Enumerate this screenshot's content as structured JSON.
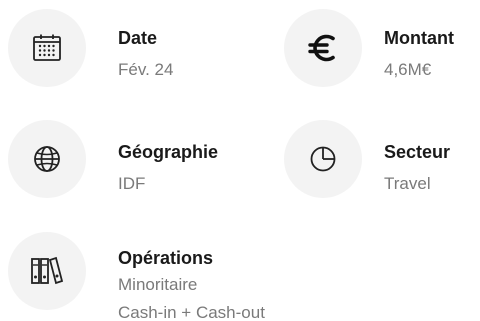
{
  "items": [
    {
      "id": "date",
      "label": "Date",
      "values": [
        "Fév. 24"
      ],
      "icon": "calendar-icon"
    },
    {
      "id": "montant",
      "label": "Montant",
      "values": [
        "4,6M€"
      ],
      "icon": "euro-icon"
    },
    {
      "id": "geographie",
      "label": "Géographie",
      "values": [
        "IDF"
      ],
      "icon": "globe-icon"
    },
    {
      "id": "secteur",
      "label": "Secteur",
      "values": [
        "Travel"
      ],
      "icon": "pie-chart-icon"
    },
    {
      "id": "operations",
      "label": "Opérations",
      "values": [
        "Minoritaire",
        "Cash-in + Cash-out"
      ],
      "icon": "binders-icon"
    }
  ],
  "colors": {
    "circle_bg": "#f3f3f3",
    "label": "#1a1a1a",
    "value": "#7a7a7a"
  }
}
